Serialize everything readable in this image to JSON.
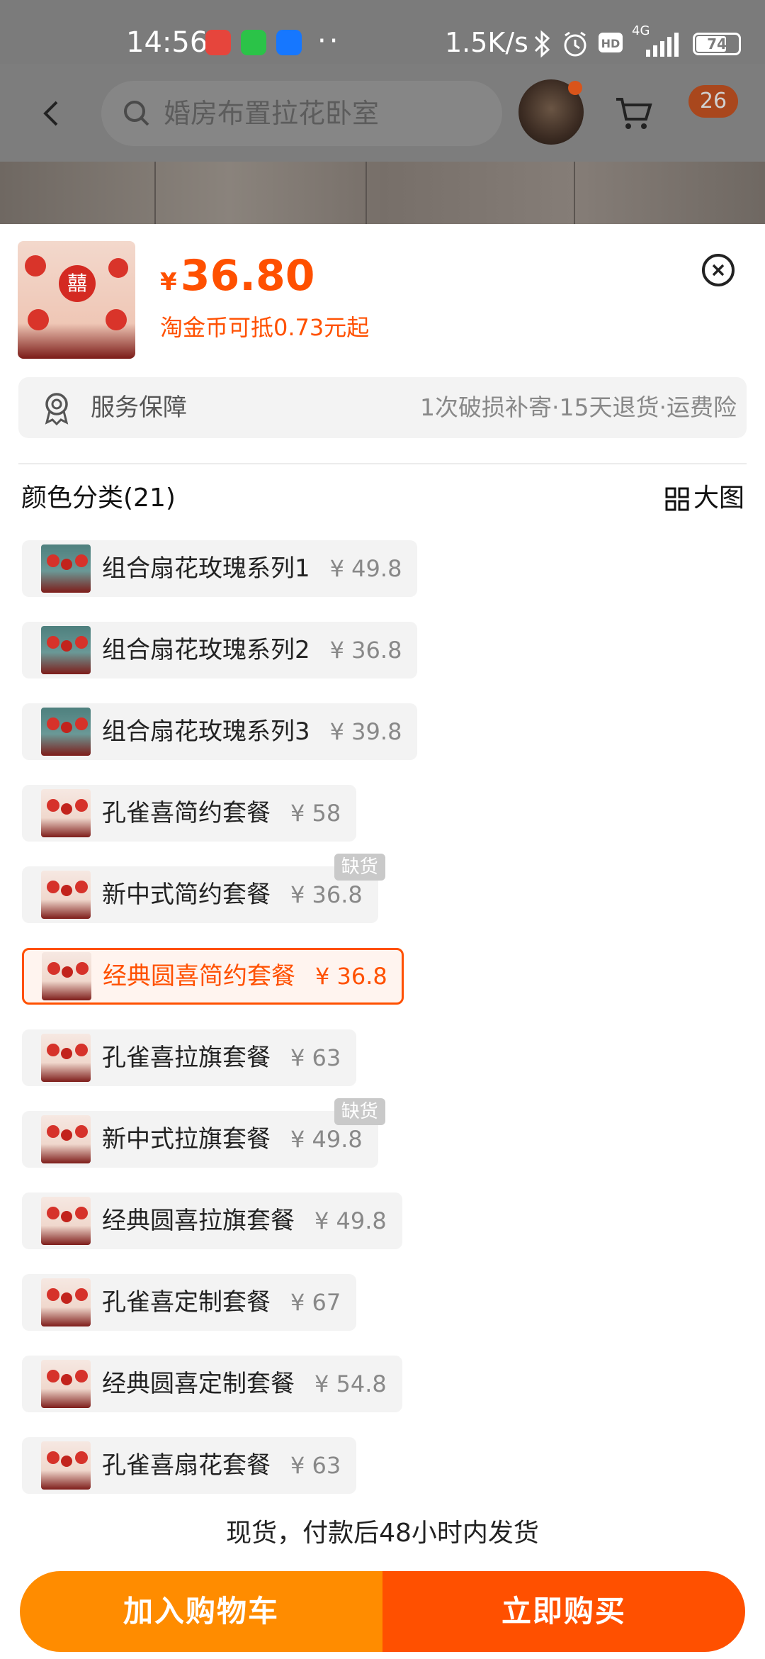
{
  "status_bar": {
    "time": "14:56",
    "dots": "··",
    "net_speed": "1.5K/s",
    "network": "4G",
    "battery": "74"
  },
  "header": {
    "search_text": "婚房布置拉花卧室",
    "cart_count": "26"
  },
  "product": {
    "currency": "¥",
    "price": "36.80",
    "coin_note": "淘金币可抵0.73元起",
    "thumb_mark": "囍"
  },
  "service": {
    "title": "服务保障",
    "detail": "1次破损补寄·15天退货·运费险"
  },
  "category": {
    "title": "颜色分类(21)",
    "big_image_label": "大图"
  },
  "options": [
    {
      "label": "组合扇花玫瑰系列1",
      "price": "¥ 49.8",
      "thumb": "teal"
    },
    {
      "label": "组合扇花玫瑰系列2",
      "price": "¥ 36.8",
      "thumb": "teal"
    },
    {
      "label": "组合扇花玫瑰系列3",
      "price": "¥ 39.8",
      "thumb": "teal"
    },
    {
      "label": "孔雀喜简约套餐",
      "price": "¥ 58",
      "thumb": "cream"
    },
    {
      "label": "新中式简约套餐",
      "price": "¥ 36.8",
      "thumb": "cream",
      "badge": "缺货"
    },
    {
      "label": "经典圆喜简约套餐",
      "price": "¥ 36.8",
      "thumb": "cream",
      "selected": true
    },
    {
      "label": "孔雀喜拉旗套餐",
      "price": "¥ 63",
      "thumb": "cream"
    },
    {
      "label": "新中式拉旗套餐",
      "price": "¥ 49.8",
      "thumb": "cream",
      "badge": "缺货"
    },
    {
      "label": "经典圆喜拉旗套餐",
      "price": "¥ 49.8",
      "thumb": "cream"
    },
    {
      "label": "孔雀喜定制套餐",
      "price": "¥ 67",
      "thumb": "cream"
    },
    {
      "label": "经典圆喜定制套餐",
      "price": "¥ 54.8",
      "thumb": "cream"
    },
    {
      "label": "孔雀喜扇花套餐",
      "price": "¥ 63",
      "thumb": "cream"
    }
  ],
  "footer": {
    "ship_note": "现货，付款后48小时内发货",
    "add_to_cart": "加入购物车",
    "buy_now": "立即购买"
  },
  "colors": {
    "accent": "#ff5000",
    "cart_button": "#ff8c00",
    "buy_button": "#ff5000"
  }
}
